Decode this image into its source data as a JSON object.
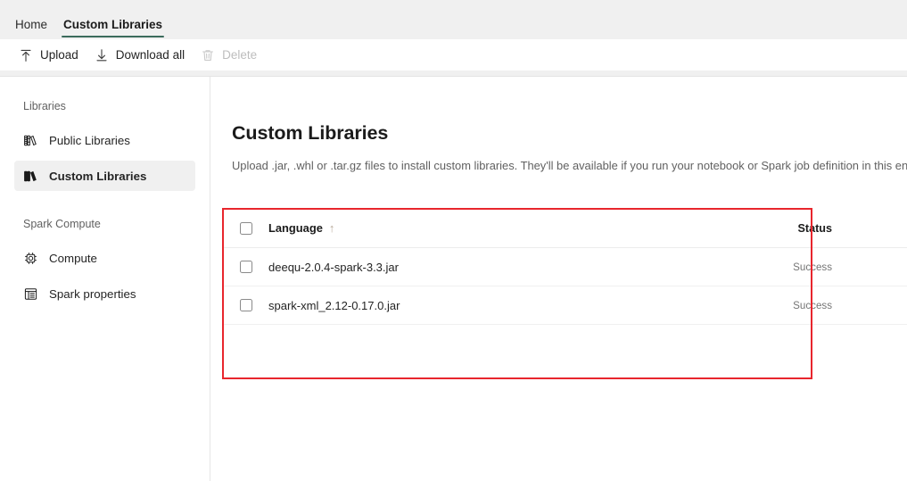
{
  "tabs": [
    {
      "label": "Home",
      "active": false
    },
    {
      "label": "Custom Libraries",
      "active": true
    }
  ],
  "toolbar": {
    "upload_label": "Upload",
    "download_all_label": "Download all",
    "delete_label": "Delete"
  },
  "sidebar": {
    "group_libraries": "Libraries",
    "group_spark_compute": "Spark Compute",
    "items": [
      {
        "label": "Public Libraries",
        "icon": "public-libraries-icon",
        "selected": false
      },
      {
        "label": "Custom Libraries",
        "icon": "custom-libraries-icon",
        "selected": true
      },
      {
        "label": "Compute",
        "icon": "compute-chip-icon",
        "selected": false
      },
      {
        "label": "Spark properties",
        "icon": "spark-properties-icon",
        "selected": false
      }
    ]
  },
  "main": {
    "title": "Custom Libraries",
    "description": "Upload .jar, .whl or .tar.gz files to install custom libraries. They'll be available if you run your notebook or Spark job definition in this environment."
  },
  "table": {
    "columns": {
      "language": "Language",
      "sort_indicator": "↑",
      "status": "Status"
    },
    "rows": [
      {
        "name": "deequ-2.0.4-spark-3.3.jar",
        "status": "Success",
        "checked": false
      },
      {
        "name": "spark-xml_2.12-0.17.0.jar",
        "status": "Success",
        "checked": false
      }
    ]
  },
  "annotation": {
    "highlight_color": "#e8262d"
  }
}
